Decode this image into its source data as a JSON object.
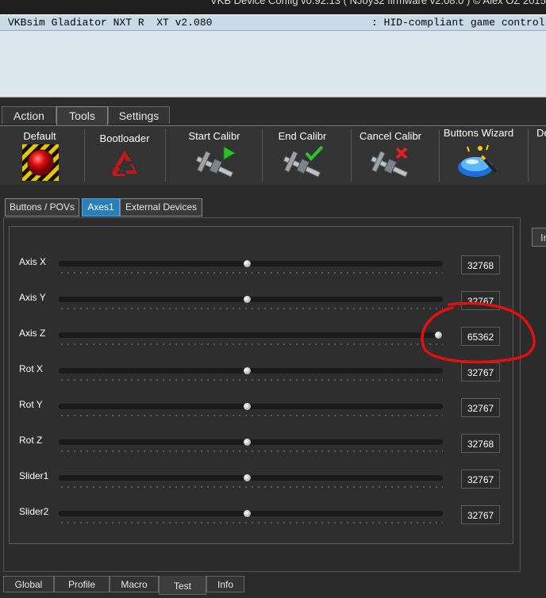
{
  "window": {
    "title": "VKB Device Config v0.92.13 ( NJoy32 firmware v2.08.0 ) © Alex OZ 2015"
  },
  "device": {
    "name": "VKBsim Gladiator NXT R  XT v2.080",
    "type": ": HID-compliant game controller"
  },
  "main_tabs": [
    {
      "label": "Action"
    },
    {
      "label": "Tools"
    },
    {
      "label": "Settings"
    }
  ],
  "tools": [
    {
      "label": "Default",
      "icon": "red-button-icon"
    },
    {
      "label": "Bootloader",
      "icon": "recycle-icon"
    },
    {
      "label": "Start Calibr",
      "icon": "caliper-play-icon"
    },
    {
      "label": "End Calibr",
      "icon": "caliper-check-icon"
    },
    {
      "label": "Cancel Calibr",
      "icon": "caliper-cancel-icon"
    },
    {
      "label": "Buttons Wizard",
      "icon": "wizard-button-icon"
    },
    {
      "label": "De"
    }
  ],
  "sub_tabs": [
    {
      "label": "Buttons / POVs"
    },
    {
      "label": "Axes1"
    },
    {
      "label": "External Devices"
    }
  ],
  "right_button": {
    "label": "In"
  },
  "axes": [
    {
      "name": "Axis X",
      "value": "32768",
      "position": 0.5
    },
    {
      "name": "Axis Y",
      "value": "32767",
      "position": 0.5
    },
    {
      "name": "Axis Z",
      "value": "65362",
      "position": 0.997
    },
    {
      "name": "Rot X",
      "value": "32767",
      "position": 0.5
    },
    {
      "name": "Rot Y",
      "value": "32767",
      "position": 0.5
    },
    {
      "name": "Rot Z",
      "value": "32768",
      "position": 0.5
    },
    {
      "name": "Slider1",
      "value": "32767",
      "position": 0.5
    },
    {
      "name": "Slider2",
      "value": "32767",
      "position": 0.5
    }
  ],
  "bottom_tabs": [
    {
      "label": "Global"
    },
    {
      "label": "Profile"
    },
    {
      "label": "Macro"
    },
    {
      "label": "Test"
    },
    {
      "label": "Info"
    }
  ],
  "colors": {
    "accent": "#2a7fb8",
    "annotation": "#e01010"
  }
}
